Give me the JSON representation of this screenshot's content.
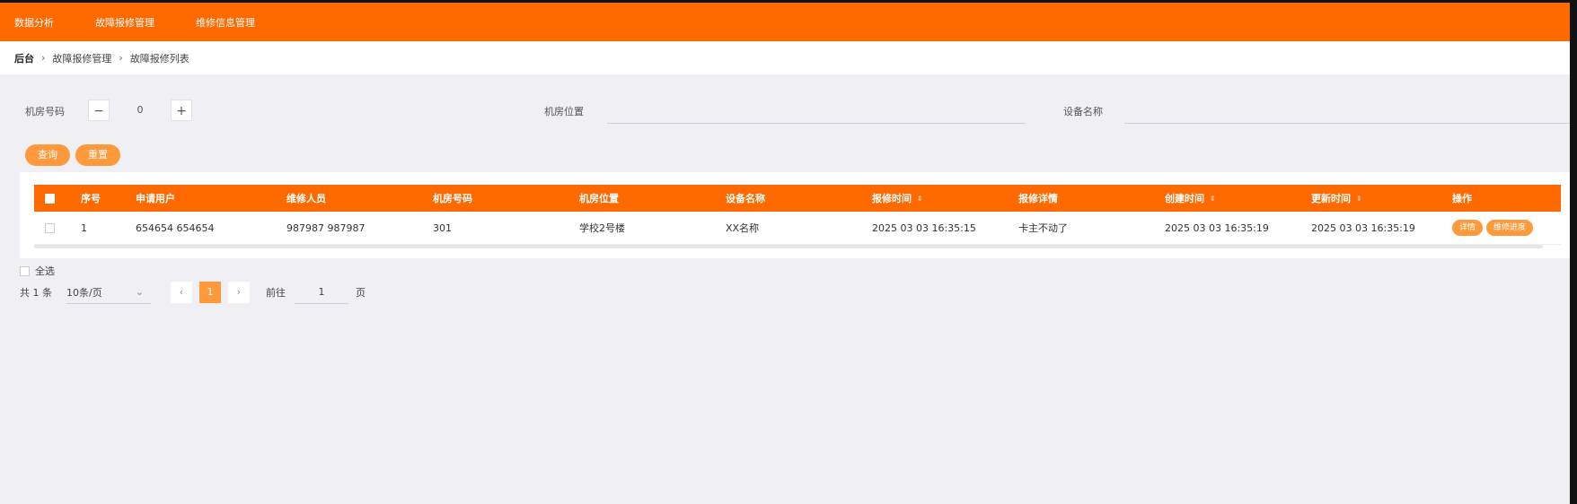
{
  "nav": {
    "items": [
      "数据分析",
      "故障报修管理",
      "维修信息管理"
    ]
  },
  "breadcrumb": {
    "root": "后台",
    "level1": "故障报修管理",
    "level2": "故障报修列表"
  },
  "filters": {
    "room_number_label": "机房号码",
    "room_number_value": "0",
    "minus": "−",
    "plus": "+",
    "room_location_label": "机房位置",
    "device_name_label": "设备名称"
  },
  "actions": {
    "query": "查询",
    "reset": "重置"
  },
  "table": {
    "headers": {
      "index": "序号",
      "applicant": "申请用户",
      "repairer": "维修人员",
      "room_number": "机房号码",
      "room_location": "机房位置",
      "device_name": "设备名称",
      "report_time": "报修时间",
      "details": "报修详情",
      "created": "创建时间",
      "updated": "更新时间",
      "actions": "操作"
    },
    "sort_icon": "⇕",
    "rows": [
      {
        "index": "1",
        "applicant": "654654 654654",
        "repairer": "987987 987987",
        "room_number": "301",
        "room_location": "学校2号楼",
        "device_name": "XX名称",
        "report_time": "2025 03 03 16:35:15",
        "details": "卡主不动了",
        "created": "2025 03 03 16:35:19",
        "updated": "2025 03 03 16:35:19",
        "btn_detail": "详情",
        "btn_progress": "维修进度"
      }
    ]
  },
  "footer": {
    "select_all": "全选",
    "total": "共 1 条",
    "page_size": "10条/页",
    "prev": "‹",
    "current_page": "1",
    "next": "›",
    "goto_label": "前往",
    "goto_value": "1",
    "goto_suffix": "页"
  },
  "colors": {
    "brand": "#ff6a00",
    "button": "#ff9a3c",
    "background": "#efeff4"
  }
}
